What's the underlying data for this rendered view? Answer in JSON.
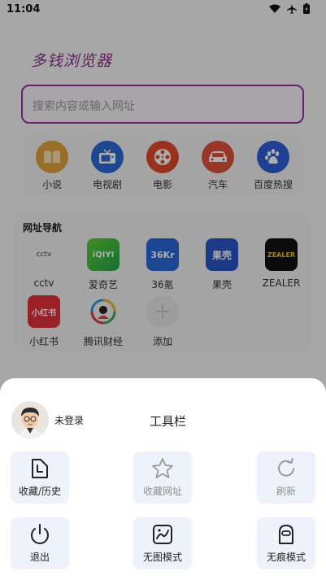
{
  "status_bar": {
    "time": "11:04"
  },
  "app": {
    "title": "多钱浏览器"
  },
  "search": {
    "placeholder": "搜索内容或输入网址"
  },
  "quick_links": [
    {
      "label": "小说",
      "icon": "book-icon",
      "color": "#e2a23a"
    },
    {
      "label": "电视剧",
      "icon": "tv-icon",
      "color": "#2b6bd6"
    },
    {
      "label": "电影",
      "icon": "film-reel-icon",
      "color": "#e14a2f"
    },
    {
      "label": "汽车",
      "icon": "car-icon",
      "color": "#e0503c"
    },
    {
      "label": "百度热搜",
      "icon": "baidu-paw-icon",
      "color": "#2e5fd8"
    }
  ],
  "nav": {
    "title": "网址导航",
    "items": [
      {
        "label": "cctv",
        "logo_text": "cctv"
      },
      {
        "label": "爱奇艺",
        "logo_text": "iQIYI"
      },
      {
        "label": "36氪",
        "logo_text": "36Kr"
      },
      {
        "label": "果壳",
        "logo_text": "果壳"
      },
      {
        "label": "ZEALER",
        "logo_text": "ZEALER"
      },
      {
        "label": "小红书",
        "logo_text": "小红书"
      },
      {
        "label": "腾讯财经",
        "logo_text": ""
      },
      {
        "label": "添加",
        "logo_text": "+"
      }
    ]
  },
  "sheet": {
    "login_text": "未登录",
    "title": "工具栏",
    "tools": [
      {
        "label": "收藏/历史",
        "icon": "bookmark-history-icon",
        "enabled": true
      },
      {
        "label": "收藏网址",
        "icon": "star-icon",
        "enabled": false
      },
      {
        "label": "刷新",
        "icon": "refresh-icon",
        "enabled": false
      },
      {
        "label": "退出",
        "icon": "power-icon",
        "enabled": true
      },
      {
        "label": "无图模式",
        "icon": "no-image-icon",
        "enabled": true
      },
      {
        "label": "无痕模式",
        "icon": "incognito-icon",
        "enabled": true
      }
    ]
  },
  "colors": {
    "accent": "#a0309f",
    "sheet_bg": "#ffffff",
    "tool_bg": "#eef3fb"
  }
}
